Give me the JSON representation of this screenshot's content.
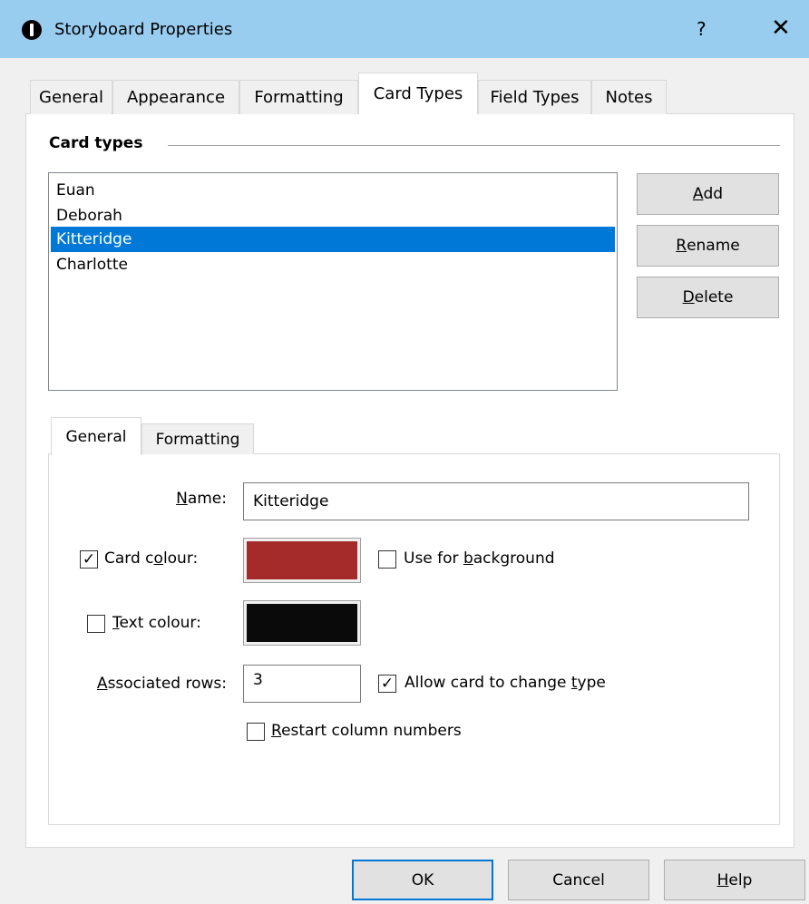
{
  "window": {
    "title": "Storyboard Properties",
    "help_glyph": "?",
    "close_glyph": "✕"
  },
  "tabs": [
    {
      "label": "General"
    },
    {
      "label": "Appearance"
    },
    {
      "label": "Formatting"
    },
    {
      "label": "Card Types",
      "active": true
    },
    {
      "label": "Field Types"
    },
    {
      "label": "Notes"
    }
  ],
  "card_types_group": {
    "label": "Card types",
    "items": [
      "Euan",
      "Deborah",
      "Kitteridge",
      "Charlotte"
    ],
    "selected": "Kitteridge"
  },
  "side_buttons": {
    "add": "Add",
    "rename": "Rename",
    "delete": "Delete"
  },
  "inner_tabs": [
    {
      "label": "General",
      "active": true
    },
    {
      "label": "Formatting"
    }
  ],
  "form": {
    "name_label": "Name:",
    "name_value": "Kitteridge",
    "card_colour_label": "Card colour:",
    "card_colour_checked": true,
    "card_colour": "#a52a2a",
    "use_for_background_label": "Use for background",
    "use_for_background_checked": false,
    "text_colour_label": "Text colour:",
    "text_colour_checked": false,
    "text_colour": "#0a0a0a",
    "associated_rows_label": "Associated rows:",
    "associated_rows_value": "3",
    "allow_change_type_label": "Allow card to change type",
    "allow_change_type_checked": true,
    "restart_column_numbers_label": "Restart column numbers",
    "restart_column_numbers_checked": false
  },
  "footer_buttons": {
    "ok": "OK",
    "cancel": "Cancel",
    "help": "Help"
  },
  "colors": {
    "titlebar": "#99cdf0",
    "selection": "#0078d7"
  }
}
